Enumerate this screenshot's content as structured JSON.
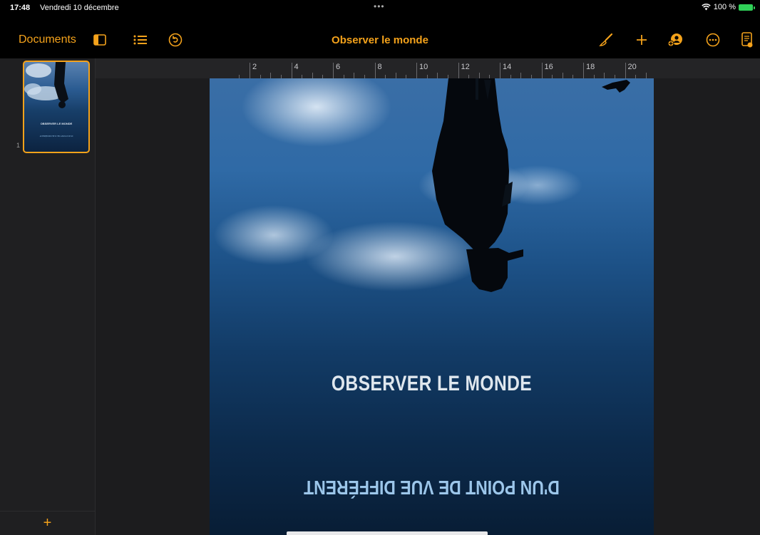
{
  "status_bar": {
    "time": "17:48",
    "date": "Vendredi 10 décembre",
    "dots": "•••",
    "battery_text": "100 %"
  },
  "toolbar": {
    "documents_label": "Documents",
    "title": "Observer le monde",
    "accent_color": "#f4a21b",
    "icons": [
      "sidebar-icon",
      "list-icon",
      "undo-icon",
      "paintbrush-icon",
      "plus-icon",
      "collaborate-icon",
      "more-icon",
      "document-icon"
    ]
  },
  "sidebar": {
    "thumbnail_title": "OBSERVER LE MONDE",
    "thumbnail_subtitle": "D'UN POINT DE VUE DIFFÉRENT",
    "page_number": "1",
    "add_label": "+"
  },
  "ruler": {
    "labels": [
      "2",
      "4",
      "6",
      "8",
      "10",
      "12",
      "14",
      "16",
      "18",
      "20"
    ]
  },
  "page": {
    "title": "OBSERVER LE MONDE",
    "subtitle": "D'UN POINT DE VUE DIFFÉRENT"
  }
}
